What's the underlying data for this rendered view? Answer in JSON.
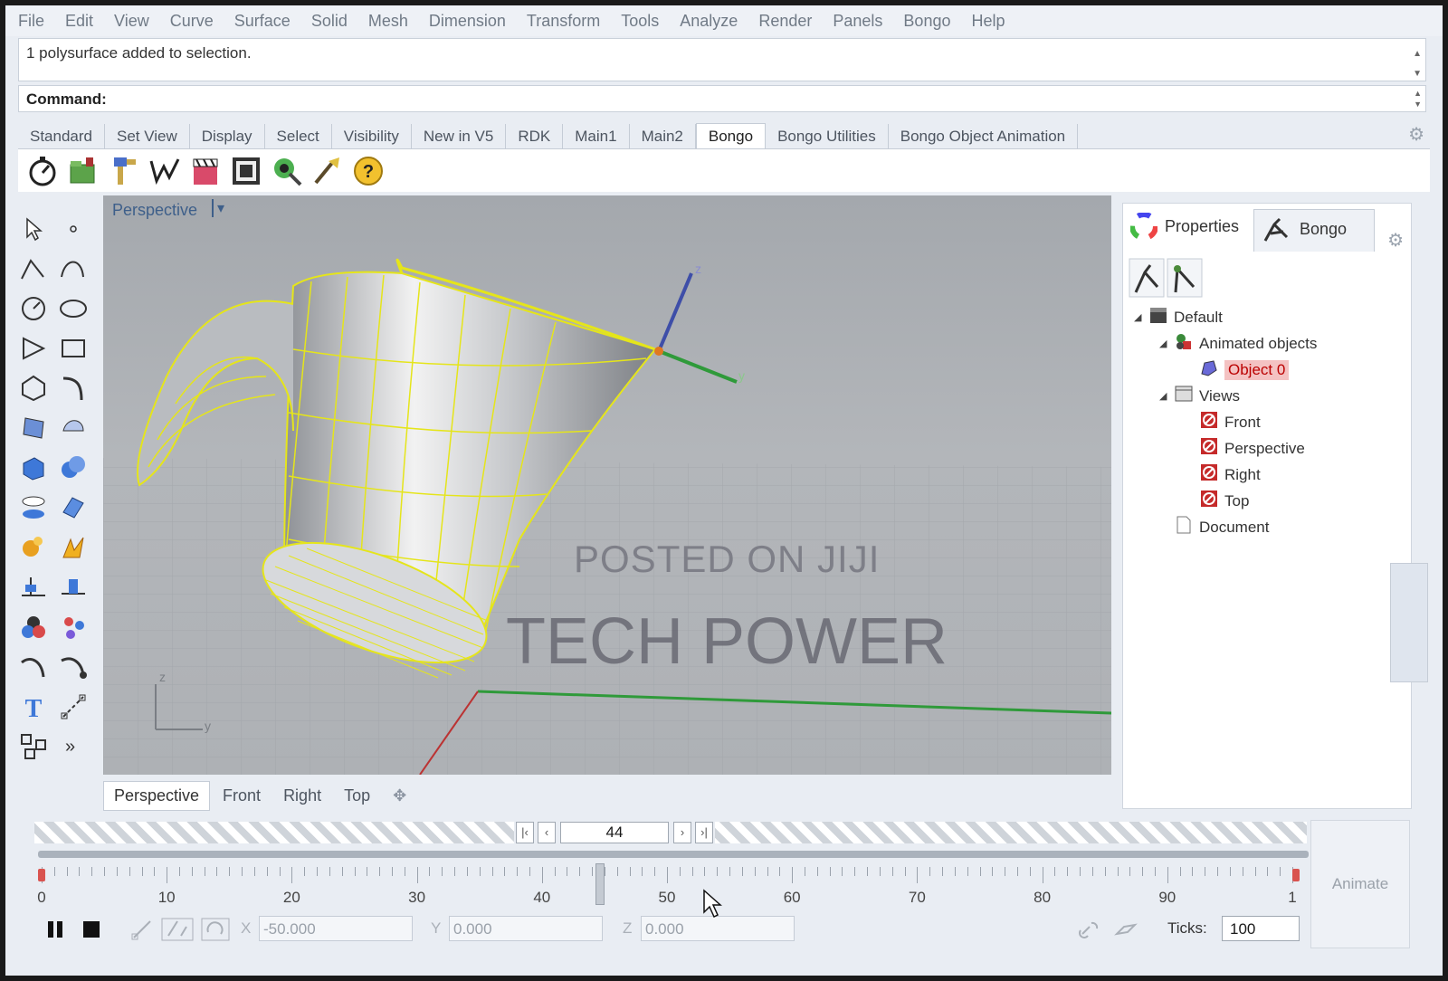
{
  "menu": [
    "File",
    "Edit",
    "View",
    "Curve",
    "Surface",
    "Solid",
    "Mesh",
    "Dimension",
    "Transform",
    "Tools",
    "Analyze",
    "Render",
    "Panels",
    "Bongo",
    "Help"
  ],
  "history": {
    "text": "1 polysurface added to selection."
  },
  "command": {
    "label": "Command:"
  },
  "toolbar_tabs": [
    "Standard",
    "Set View",
    "Display",
    "Select",
    "Visibility",
    "New in V5",
    "RDK",
    "Main1",
    "Main2",
    "Bongo",
    "Bongo Utilities",
    "Bongo Object Animation"
  ],
  "active_toolbar_tab": "Bongo",
  "toolbar_icons": [
    "stopwatch-icon",
    "folder-icon",
    "key-icon",
    "curve-icon",
    "clapper-icon",
    "render-icon",
    "target-icon",
    "wand-icon",
    "help-icon"
  ],
  "viewport": {
    "title": "Perspective",
    "axis_labels": {
      "z": "z",
      "y": "y"
    },
    "watermark_line1": "POSTED ON JIJI",
    "watermark_line2": "TECH POWER"
  },
  "viewport_tabs": [
    "Perspective",
    "Front",
    "Right",
    "Top"
  ],
  "panel": {
    "tabs": [
      "Properties",
      "Bongo"
    ],
    "tree": [
      {
        "label": "Default",
        "level": 0,
        "icon": "clapper-icon"
      },
      {
        "label": "Animated objects",
        "level": 1,
        "icon": "shapes-icon"
      },
      {
        "label": "Object 0",
        "level": 2,
        "icon": "object-icon",
        "selected": true
      },
      {
        "label": "Views",
        "level": 1,
        "icon": "views-icon"
      },
      {
        "label": "Front",
        "level": 2,
        "icon": "view-icon"
      },
      {
        "label": "Perspective",
        "level": 2,
        "icon": "view-icon"
      },
      {
        "label": "Right",
        "level": 2,
        "icon": "view-icon"
      },
      {
        "label": "Top",
        "level": 2,
        "icon": "view-icon"
      },
      {
        "label": "Document",
        "level": 1,
        "icon": "document-icon"
      }
    ]
  },
  "timeline": {
    "current_frame": "44",
    "labels": [
      "0",
      "10",
      "20",
      "30",
      "40",
      "50",
      "60",
      "70",
      "80",
      "90",
      "1"
    ],
    "x_label": "X",
    "y_label": "Y",
    "z_label": "Z",
    "x_value": "-50.000",
    "y_value": "0.000",
    "z_value": "0.000",
    "ticks_label": "Ticks:",
    "ticks_value": "100",
    "animate_label": "Animate"
  }
}
